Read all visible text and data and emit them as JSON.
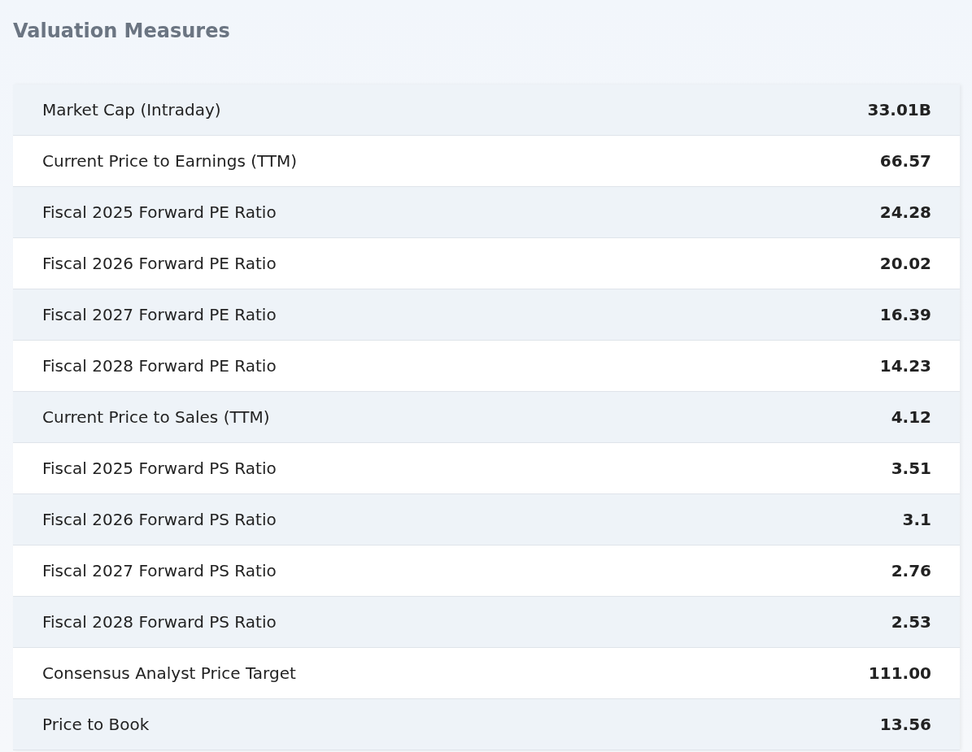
{
  "title": "Valuation Measures",
  "rows": [
    {
      "label": "Market Cap (Intraday)",
      "value": "33.01B"
    },
    {
      "label": "Current Price to Earnings (TTM)",
      "value": "66.57"
    },
    {
      "label": "Fiscal 2025 Forward PE Ratio",
      "value": "24.28"
    },
    {
      "label": "Fiscal 2026 Forward PE Ratio",
      "value": "20.02"
    },
    {
      "label": "Fiscal 2027 Forward PE Ratio",
      "value": "16.39"
    },
    {
      "label": "Fiscal 2028 Forward PE Ratio",
      "value": "14.23"
    },
    {
      "label": "Current Price to Sales (TTM)",
      "value": "4.12"
    },
    {
      "label": "Fiscal 2025 Forward PS Ratio",
      "value": "3.51"
    },
    {
      "label": "Fiscal 2026 Forward PS Ratio",
      "value": "3.1"
    },
    {
      "label": "Fiscal 2027 Forward PS Ratio",
      "value": "2.76"
    },
    {
      "label": "Fiscal 2028 Forward PS Ratio",
      "value": "2.53"
    },
    {
      "label": "Consensus Analyst Price Target",
      "value": "111.00"
    },
    {
      "label": "Price to Book",
      "value": "13.56"
    }
  ]
}
